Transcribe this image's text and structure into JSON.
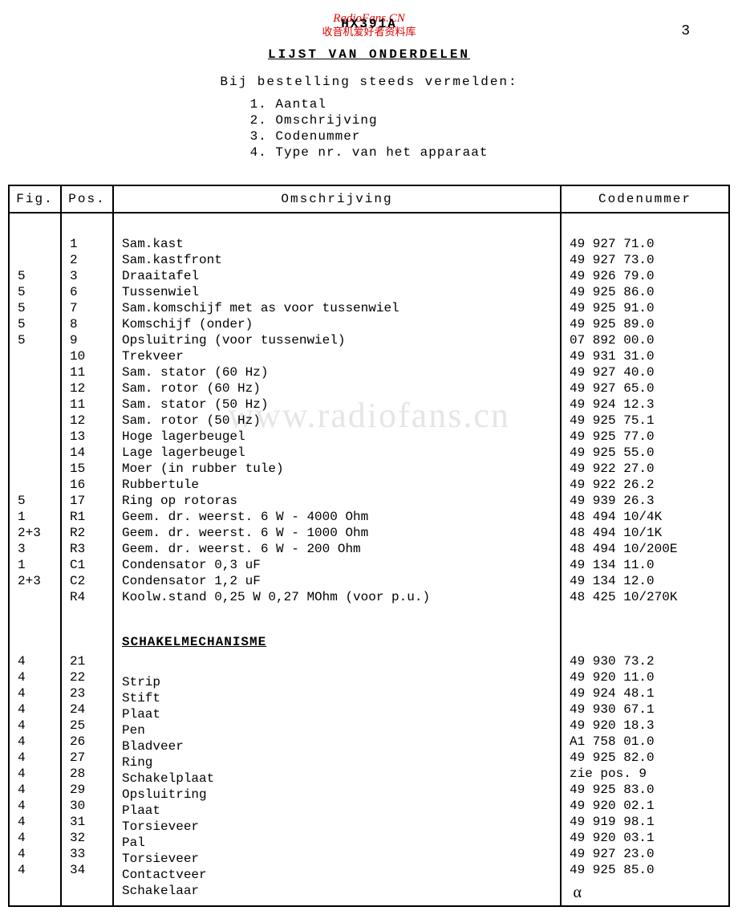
{
  "watermark_top1": "RadioFans.CN",
  "watermark_top2": "收音机爱好者资料库",
  "model": "HX391A",
  "page_number": "3",
  "title": "LIJST VAN ONDERDELEN",
  "subtitle": "Bij bestelling steeds vermelden:",
  "order_list": [
    "1. Aantal",
    "2. Omschrijving",
    "3. Codenummer",
    "4. Type nr. van het apparaat"
  ],
  "columns": {
    "fig": "Fig.",
    "pos": "Pos.",
    "desc": "Omschrijving",
    "code": "Codenummer"
  },
  "section2_title": "SCHAKELMECHANISME",
  "watermark_center": "www.radiofans.cn",
  "rows1": [
    {
      "fig": "",
      "pos": "1",
      "desc": "Sam.kast",
      "code": "49 927 71.0"
    },
    {
      "fig": "",
      "pos": "2",
      "desc": "Sam.kastfront",
      "code": "49 927 73.0"
    },
    {
      "fig": "5",
      "pos": "3",
      "desc": "Draaitafel",
      "code": "49 926 79.0"
    },
    {
      "fig": "5",
      "pos": "6",
      "desc": "Tussenwiel",
      "code": "49 925 86.0"
    },
    {
      "fig": "5",
      "pos": "7",
      "desc": "Sam.komschijf met as voor tussenwiel",
      "code": "49 925 91.0"
    },
    {
      "fig": "5",
      "pos": "8",
      "desc": "Komschijf (onder)",
      "code": "49 925 89.0"
    },
    {
      "fig": "5",
      "pos": "9",
      "desc": "Opsluitring (voor tussenwiel)",
      "code": "07 892 00.0"
    },
    {
      "fig": "",
      "pos": "10",
      "desc": "Trekveer",
      "code": "49 931 31.0"
    },
    {
      "fig": "",
      "pos": "11",
      "desc": "Sam. stator (60 Hz)",
      "code": "49 927 40.0"
    },
    {
      "fig": "",
      "pos": "12",
      "desc": "Sam. rotor  (60 Hz)",
      "code": "49 927 65.0"
    },
    {
      "fig": "",
      "pos": "11",
      "desc": "Sam. stator (50 Hz)",
      "code": "49 924 12.3"
    },
    {
      "fig": "",
      "pos": "12",
      "desc": "Sam. rotor  (50 Hz)",
      "code": "49 925 75.1"
    },
    {
      "fig": "",
      "pos": "13",
      "desc": "Hoge lagerbeugel",
      "code": "49 925 77.0"
    },
    {
      "fig": "",
      "pos": "14",
      "desc": "Lage lagerbeugel",
      "code": "49 925 55.0"
    },
    {
      "fig": "",
      "pos": "15",
      "desc": "Moer (in rubber tule)",
      "code": "49 922 27.0"
    },
    {
      "fig": "",
      "pos": "16",
      "desc": "Rubbertule",
      "code": "49 922 26.2"
    },
    {
      "fig": "5",
      "pos": "17",
      "desc": "Ring op rotoras",
      "code": "49 939 26.3"
    },
    {
      "fig": "1",
      "pos": "R1",
      "desc": "Geem. dr. weerst. 6 W - 4000 Ohm",
      "code": "48 494 10/4K"
    },
    {
      "fig": "2+3",
      "pos": "R2",
      "desc": "Geem. dr. weerst. 6 W - 1000 Ohm",
      "code": "48 494 10/1K"
    },
    {
      "fig": "3",
      "pos": "R3",
      "desc": "Geem. dr. weerst. 6 W -  200 Ohm",
      "code": "48 494 10/200E"
    },
    {
      "fig": "1",
      "pos": "C1",
      "desc": "Condensator 0,3 uF",
      "code": "49 134 11.0"
    },
    {
      "fig": "2+3",
      "pos": "C2",
      "desc": "Condensator 1,2 uF",
      "code": "49 134 12.0"
    },
    {
      "fig": "",
      "pos": "R4",
      "desc": "Koolw.stand 0,25 W 0,27 MOhm (voor p.u.)",
      "code": "48 425 10/270K"
    }
  ],
  "rows2": [
    {
      "fig": "4",
      "pos": "21",
      "desc": "Strip",
      "code": "49 930 73.2"
    },
    {
      "fig": "4",
      "pos": "22",
      "desc": "Stift",
      "code": "49 920 11.0"
    },
    {
      "fig": "4",
      "pos": "23",
      "desc": "Plaat",
      "code": "49 924 48.1"
    },
    {
      "fig": "4",
      "pos": "24",
      "desc": "Pen",
      "code": "49 930 67.1"
    },
    {
      "fig": "4",
      "pos": "25",
      "desc": "Bladveer",
      "code": "49 920 18.3"
    },
    {
      "fig": "4",
      "pos": "26",
      "desc": "Ring",
      "code": "A1 758 01.0"
    },
    {
      "fig": "4",
      "pos": "27",
      "desc": "Schakelplaat",
      "code": "49 925 82.0"
    },
    {
      "fig": "4",
      "pos": "28",
      "desc": "Opsluitring",
      "code": "zie pos. 9"
    },
    {
      "fig": "4",
      "pos": "29",
      "desc": "Plaat",
      "code": "49 925 83.0"
    },
    {
      "fig": "4",
      "pos": "30",
      "desc": "Torsieveer",
      "code": "49 920 02.1"
    },
    {
      "fig": "4",
      "pos": "31",
      "desc": "Pal",
      "code": "49 919 98.1"
    },
    {
      "fig": "4",
      "pos": "32",
      "desc": "Torsieveer",
      "code": "49 920 03.1"
    },
    {
      "fig": "4",
      "pos": "33",
      "desc": "Contactveer",
      "code": "49 927 23.0"
    },
    {
      "fig": "4",
      "pos": "34",
      "desc": "Schakelaar",
      "code": "49 925 85.0"
    }
  ]
}
